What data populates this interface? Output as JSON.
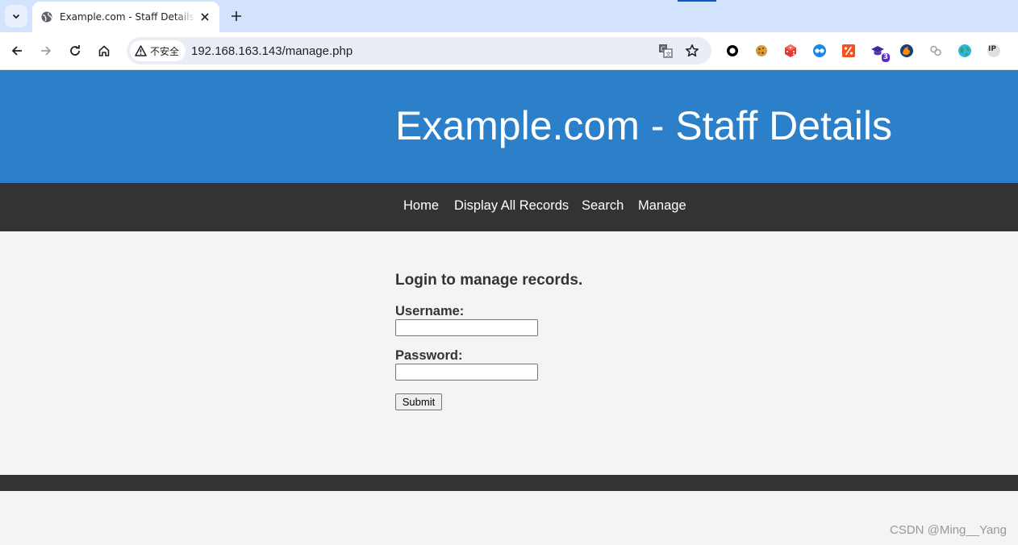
{
  "browser": {
    "tab": {
      "title": "Example.com - Staff Details - Mozilla...",
      "favicon": "globe-icon"
    },
    "address": {
      "security_label": "不安全",
      "url": "192.168.163.143/manage.php"
    },
    "accent_color": "#0b57d0",
    "extensions": [
      {
        "name": "circle-extension-icon"
      },
      {
        "name": "cookie-extension-icon"
      },
      {
        "name": "dice-extension-icon"
      },
      {
        "name": "glasses-extension-icon"
      },
      {
        "name": "percent-extension-icon"
      },
      {
        "name": "graduation-extension-icon",
        "badge": "3"
      },
      {
        "name": "firefox-extension-icon"
      },
      {
        "name": "link-extension-icon"
      },
      {
        "name": "earth-extension-icon"
      },
      {
        "name": "ip-extension-icon",
        "text": "IP"
      }
    ]
  },
  "site": {
    "title": "Example.com - Staff Details",
    "header_color": "#2b80c9",
    "nav_color": "#333333",
    "nav": [
      "Home",
      "Display All Records",
      "Search",
      "Manage"
    ]
  },
  "login": {
    "heading": "Login to manage records.",
    "username_label": "Username:",
    "username_value": "",
    "password_label": "Password:",
    "password_value": "",
    "submit_label": "Submit"
  },
  "watermark": "CSDN @Ming__Yang"
}
